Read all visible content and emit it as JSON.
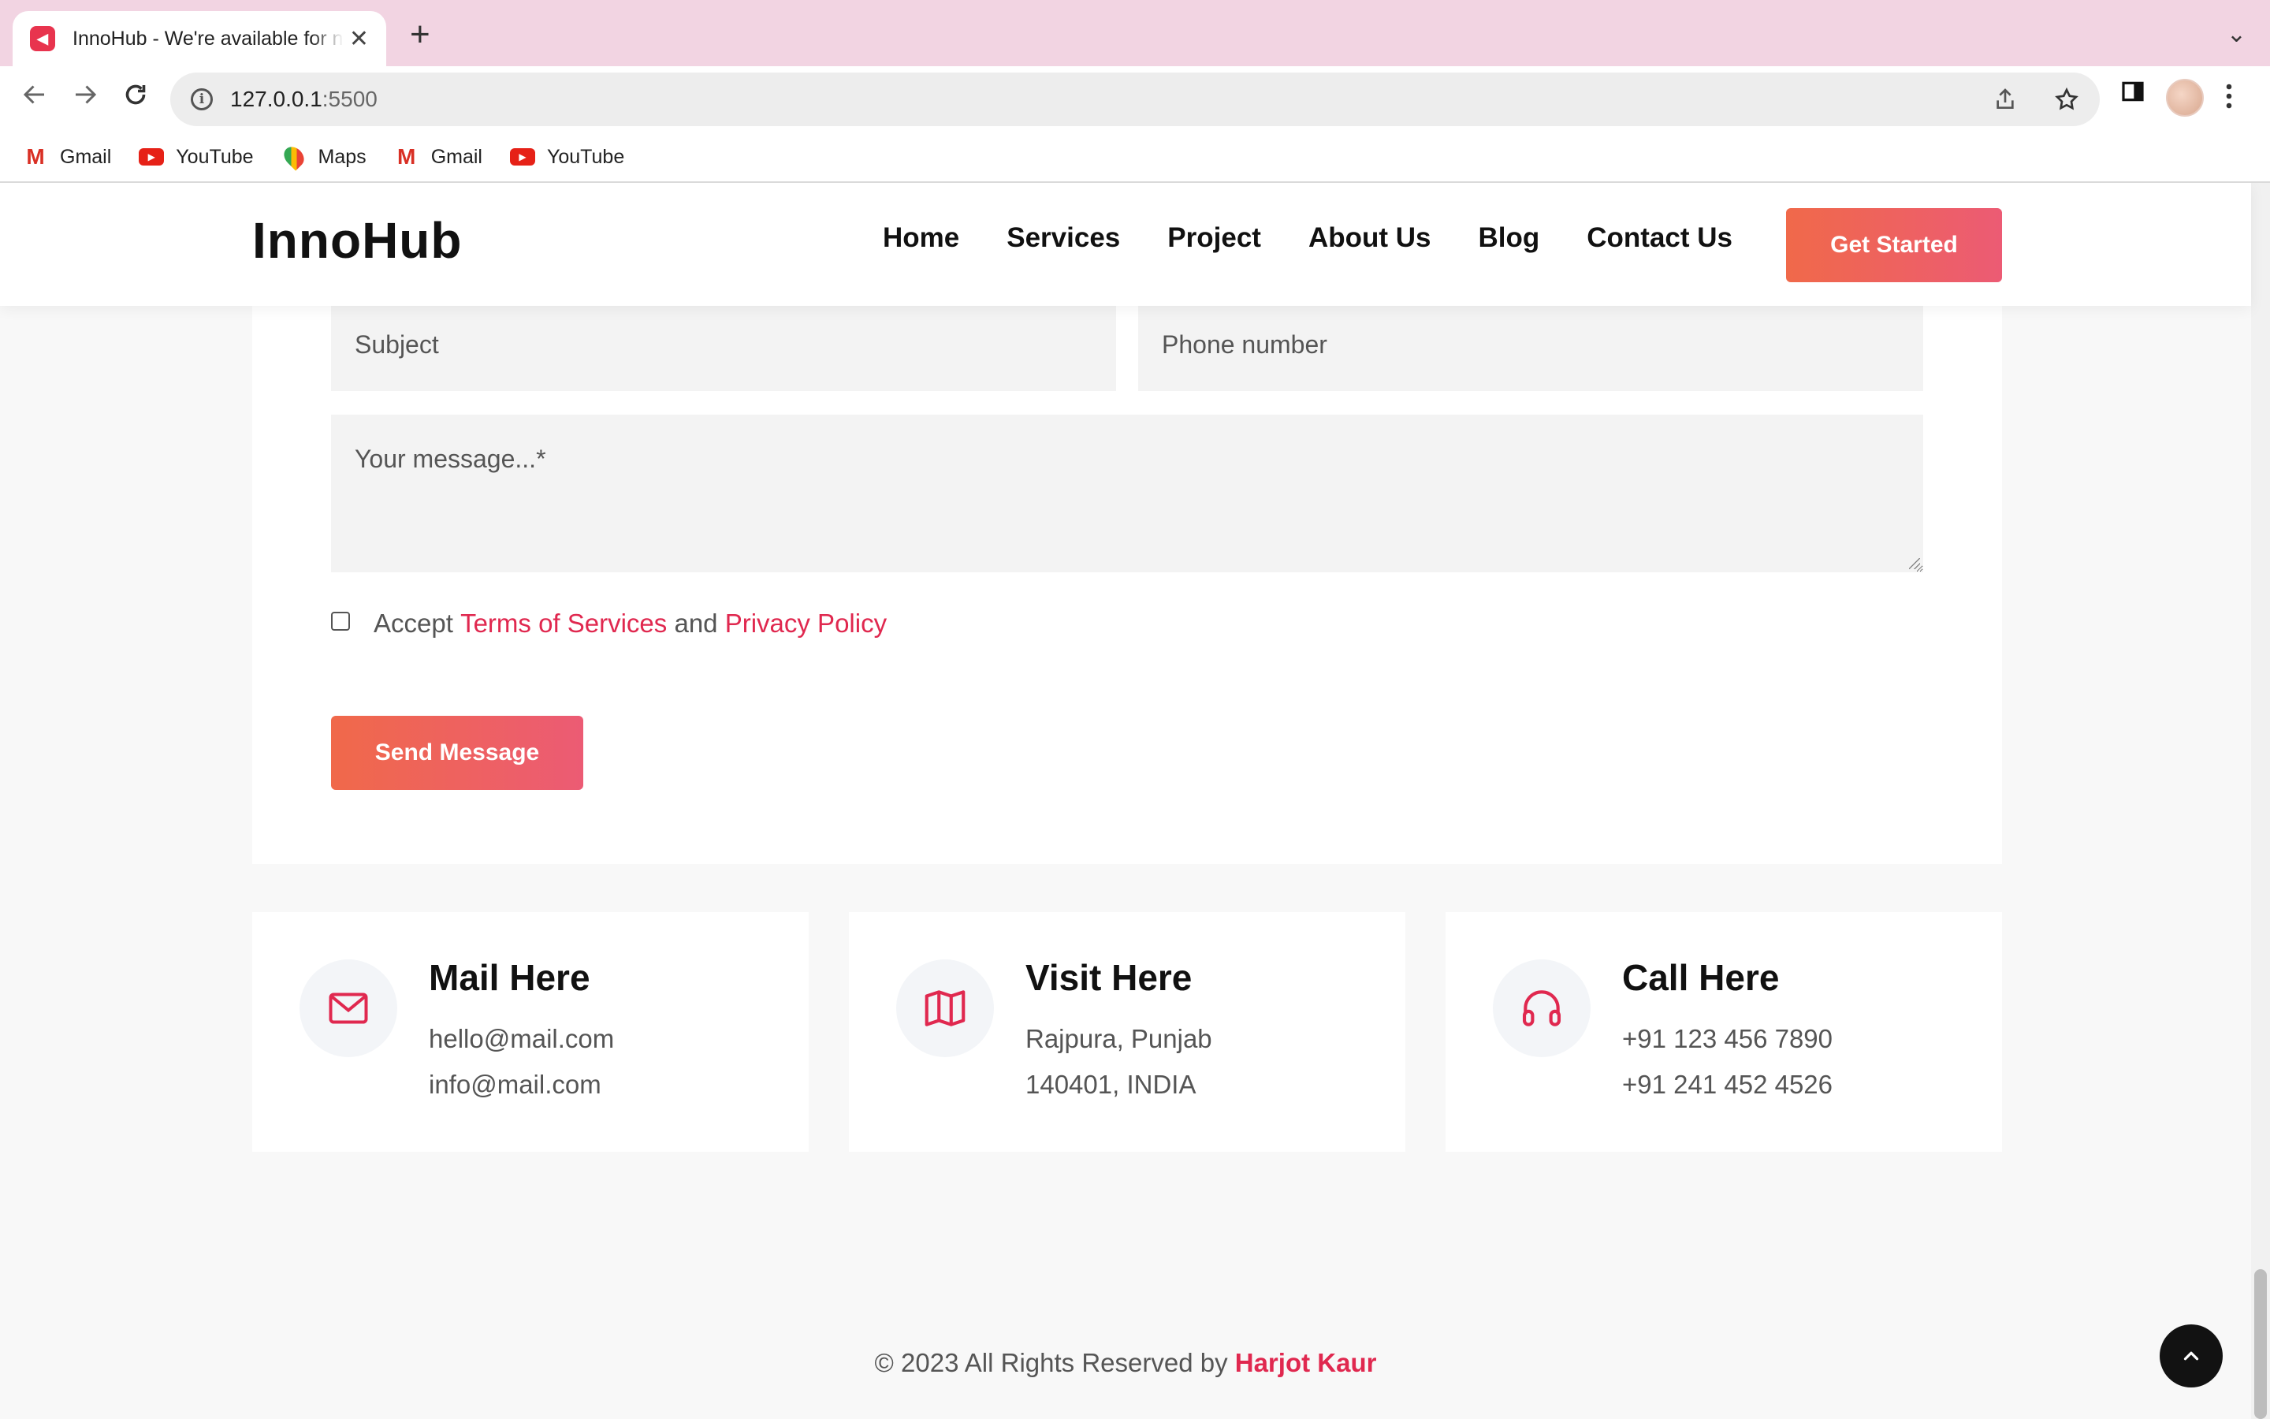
{
  "browser": {
    "tab_title": "InnoHub - We're available for new projects",
    "tab_close": "✕",
    "new_tab": "+",
    "tab_dropdown": "⌄",
    "url_host": "127.0.0.1",
    "url_port": ":5500",
    "bookmarks": [
      {
        "label": "Gmail",
        "icon": "gmail-icon"
      },
      {
        "label": "YouTube",
        "icon": "youtube-icon"
      },
      {
        "label": "Maps",
        "icon": "maps-icon"
      },
      {
        "label": "Gmail",
        "icon": "gmail-icon"
      },
      {
        "label": "YouTube",
        "icon": "youtube-icon"
      }
    ]
  },
  "header": {
    "logo": "InnoHub",
    "nav": [
      "Home",
      "Services",
      "Project",
      "About Us",
      "Blog",
      "Contact Us"
    ],
    "cta": "Get Started"
  },
  "form": {
    "subject_placeholder": "Subject",
    "phone_placeholder": "Phone number",
    "message_placeholder": "Your message...*",
    "accept_prefix": "Accept",
    "terms_link": "Terms of Services",
    "and_text": "and",
    "privacy_link": "Privacy Policy",
    "submit": "Send Message"
  },
  "info_cards": [
    {
      "title": "Mail Here",
      "lines": [
        "hello@mail.com",
        "info@mail.com"
      ],
      "icon": "mail-icon"
    },
    {
      "title": "Visit Here",
      "lines": [
        "Rajpura, Punjab",
        "140401, INDIA"
      ],
      "icon": "map-icon"
    },
    {
      "title": "Call Here",
      "lines": [
        "+91 123 456 7890",
        "+91 241 452 4526"
      ],
      "icon": "headphones-icon"
    }
  ],
  "footer": {
    "copyright_text": "© 2023 All Rights Reserved by",
    "author": "Harjot Kaur"
  },
  "colors": {
    "accent": "#e0284f",
    "gradient_start": "#f0694a",
    "gradient_end": "#ec5b74",
    "tabbar": "#f2d4e2"
  }
}
